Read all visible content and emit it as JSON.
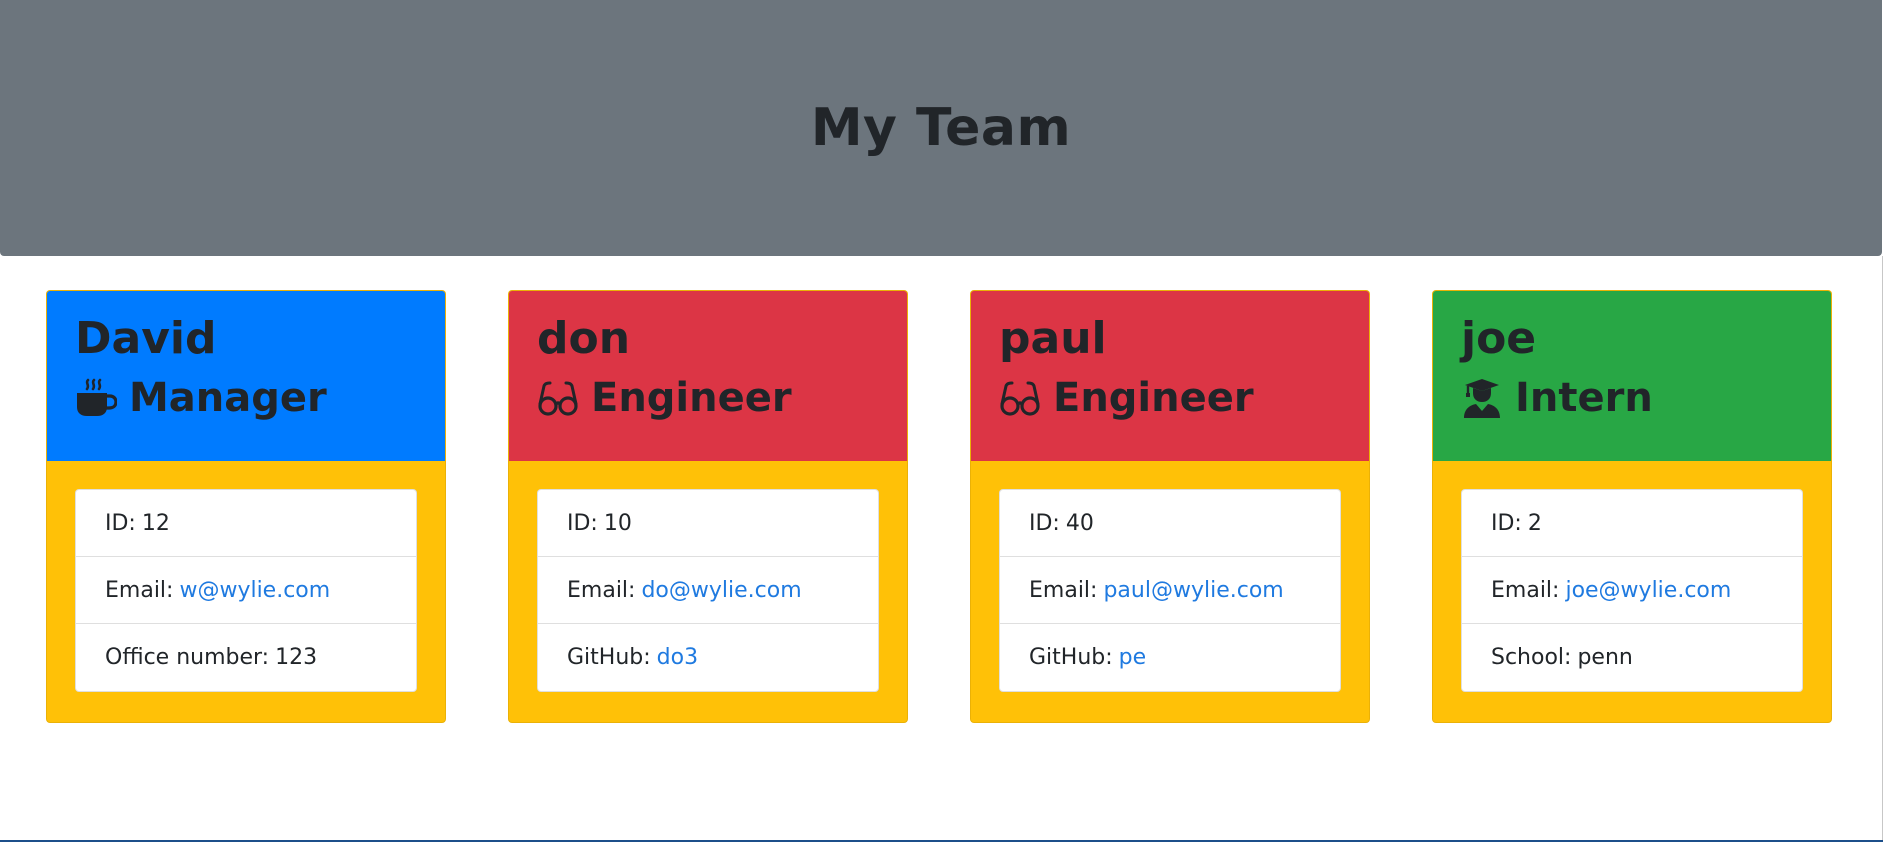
{
  "header": {
    "title": "My Team"
  },
  "colors": {
    "manager": "#007bff",
    "engineer": "#dc3545",
    "intern": "#28a745",
    "body": "#ffc107",
    "link": "#1f7ae0"
  },
  "cards": [
    {
      "name": "David",
      "role": "Manager",
      "icon": "coffee-icon",
      "id_label": "ID:",
      "id": "12",
      "email_label": "Email:",
      "email": "w@wylie.com",
      "extra_label": "Office number:",
      "extra": "123",
      "extra_is_link": false
    },
    {
      "name": "don",
      "role": "Engineer",
      "icon": "glasses-icon",
      "id_label": "ID:",
      "id": "10",
      "email_label": "Email:",
      "email": "do@wylie.com",
      "extra_label": "GitHub:",
      "extra": "do3",
      "extra_is_link": true
    },
    {
      "name": "paul",
      "role": "Engineer",
      "icon": "glasses-icon",
      "id_label": "ID:",
      "id": "40",
      "email_label": "Email:",
      "email": "paul@wylie.com",
      "extra_label": "GitHub:",
      "extra": "pe",
      "extra_is_link": true
    },
    {
      "name": "joe",
      "role": "Intern",
      "icon": "graduate-icon",
      "id_label": "ID:",
      "id": "2",
      "email_label": "Email:",
      "email": "joe@wylie.com",
      "extra_label": "School:",
      "extra": "penn",
      "extra_is_link": false
    }
  ]
}
